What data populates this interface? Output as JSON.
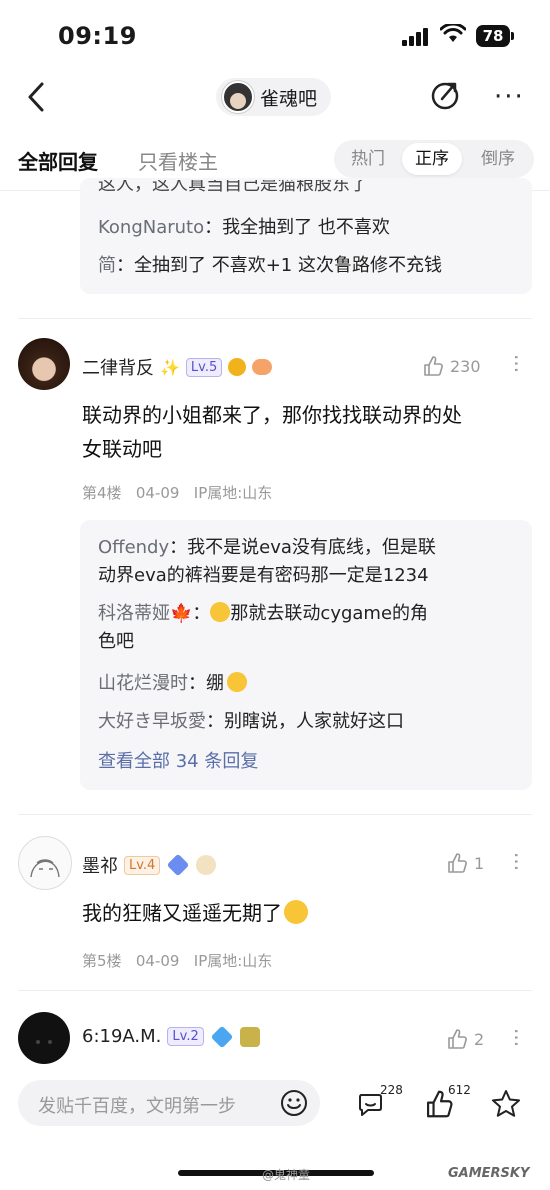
{
  "status": {
    "time": "09:19",
    "battery": "78"
  },
  "nav": {
    "forum_name": "雀魂吧"
  },
  "tabs": {
    "all": "全部回复",
    "owner": "只看楼主",
    "sort": [
      "热门",
      "正序",
      "倒序"
    ],
    "active_sort": "正序"
  },
  "top_replies": {
    "partial": "这人，这人真当自己是猫粮股东了",
    "lines": [
      {
        "user": "KongNaruto",
        "text": "我全抽到了 也不喜欢"
      },
      {
        "user": "简",
        "text": "全抽到了 不喜欢+1 这次鲁路修不充钱"
      }
    ]
  },
  "posts": [
    {
      "username": "二律背反",
      "level": "Lv.5",
      "likes": "230",
      "content_line1": "联动界的小姐都来了，那你找找联动界的处",
      "content_line2": "女联动吧",
      "floor": "第4楼",
      "date": "04-09",
      "location": "IP属地:山东",
      "replies": [
        {
          "user": "Offendy",
          "line1": "我不是说eva没有底线，但是联",
          "line2": "动界eva的裤裆要是有密码那一定是1234"
        },
        {
          "user": "科洛蒂娅",
          "line1": "那就去联动cygame的角",
          "line2": "色吧"
        },
        {
          "user": "山花烂漫时",
          "line1": "绷"
        },
        {
          "user": "大好き早坂愛",
          "line1": "别瞎说，人家就好这口"
        }
      ],
      "view_all": "查看全部 34 条回复"
    },
    {
      "username": "墨祁",
      "level": "Lv.4",
      "likes": "1",
      "content_line1": "我的狂赌又遥遥无期了",
      "floor": "第5楼",
      "date": "04-09",
      "location": "IP属地:山东"
    },
    {
      "username": "6:19A.M.",
      "level": "Lv.2",
      "likes": "2"
    }
  ],
  "bottom_bar": {
    "placeholder": "发贴千百度，文明第一步",
    "comments": "228",
    "likes": "612"
  },
  "watermark": {
    "weibo": "@鬼神童",
    "brand": "GAMERSKY"
  }
}
